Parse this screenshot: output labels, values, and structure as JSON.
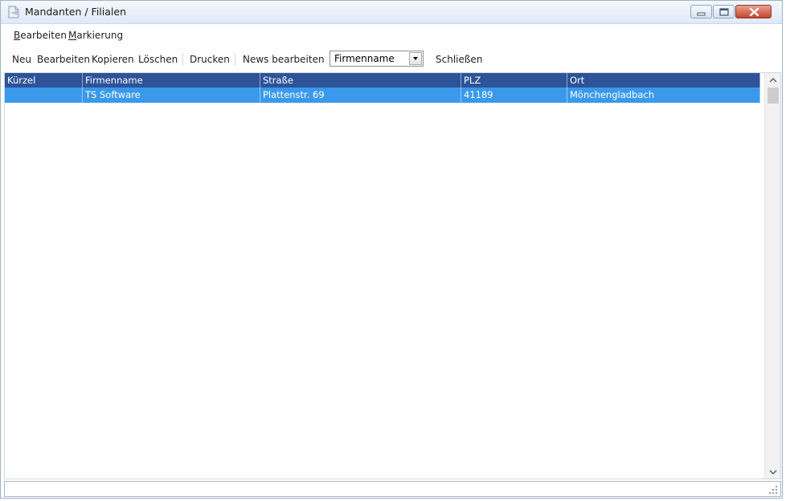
{
  "window": {
    "title": "Mandanten / Filialen"
  },
  "menubar": {
    "items": [
      {
        "accel": "B",
        "rest": "earbeiten"
      },
      {
        "accel": "M",
        "rest": "arkierung"
      }
    ]
  },
  "toolbar": {
    "new_label": "Neu",
    "edit_label": "Bearbeiten",
    "copy_label": "Kopieren",
    "delete_label": "Löschen",
    "print_label": "Drucken",
    "news_label": "News bearbeiten",
    "sort_select_value": "Firmenname",
    "close_label": "Schließen"
  },
  "grid": {
    "columns": [
      "Kürzel",
      "Firmenname",
      "Straße",
      "PLZ",
      "Ort"
    ],
    "rows": [
      {
        "kuerzel": "",
        "firmenname": "TS Software",
        "strasse": "Plattenstr. 69",
        "plz": "41189",
        "ort": "Mönchengladbach",
        "selected": true
      }
    ]
  },
  "colors": {
    "header_bg": "#2d5398",
    "selected_row_bg": "#3a99ea",
    "close_button": "#c7432c"
  },
  "icons": [
    "document-icon",
    "minimize-icon",
    "maximize-icon",
    "close-icon",
    "chevron-down-icon",
    "chevron-up-icon",
    "resize-grip-icon"
  ]
}
